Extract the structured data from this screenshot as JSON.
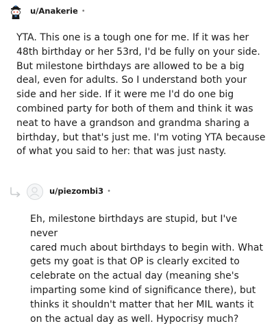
{
  "comments": [
    {
      "username": "u/Anakerie",
      "separator": "•",
      "avatar_icon": "snoo-avatar-icon",
      "body": "YTA. This one is a tough one for me. If it was her\n48th birthday or her 53rd, I'd be fully on your side.\nBut milestone birthdays are allowed to be a big\ndeal, even for adults. So I understand both your\nside and her side. If it were me I'd do one big\ncombined party for both of them and think it was\nneat to have a grandson and grandma sharing a\nbirthday, but that's just me. I'm voting YTA because\nof what you said to her: that was just nasty."
    },
    {
      "username": "u/piezombi3",
      "separator": "•",
      "avatar_icon": "default-avatar-icon",
      "reply_icon": "reply-arrow-icon",
      "body": "Eh, milestone birthdays are stupid, but I've never\ncared much about birthdays to begin with. What\ngets my goat is that OP is clearly excited to\ncelebrate on the actual day (meaning she's\nimparting some kind of significance there), but\nthinks it shouldn't matter that her MIL wants it\non the actual day as well. Hypocrisy much?"
    }
  ],
  "colors": {
    "text": "#1c1c1c",
    "muted": "#7c7c7c",
    "reply_arrow": "#c8cbcd",
    "avatar_border": "#d7dadc"
  }
}
